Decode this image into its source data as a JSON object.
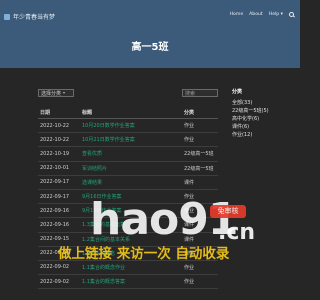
{
  "header": {
    "brand": "年少青春当有梦",
    "nav": [
      "Home",
      "About",
      "Help ▾"
    ]
  },
  "page_title": "高一5班",
  "controls": {
    "category_select": "选择分类",
    "search_placeholder": "搜索"
  },
  "table": {
    "headers": [
      "日期",
      "标题",
      "分类"
    ],
    "rows": [
      {
        "date": "2022-10-22",
        "title": "10月20日数学作业答案",
        "category": "作业"
      },
      {
        "date": "2022-10-22",
        "title": "10月21日数学作业答案",
        "category": "作业"
      },
      {
        "date": "2022-10-19",
        "title": "查看优质",
        "category": "22级高一5班"
      },
      {
        "date": "2022-10-01",
        "title": "军训结照片",
        "category": "22级高一5班"
      },
      {
        "date": "2022-09-17",
        "title": "选课结果",
        "category": "课件"
      },
      {
        "date": "2022-09-17",
        "title": "9月16日作业答案",
        "category": "作业"
      },
      {
        "date": "2022-09-16",
        "title": "9月15日作业答案",
        "category": "作业"
      },
      {
        "date": "2022-09-16",
        "title": "1.3集合的基本运算",
        "category": "课件"
      },
      {
        "date": "2022-09-15",
        "title": "1.2集合间的基本关系",
        "category": "课件"
      },
      {
        "date": "2022-09-04",
        "title": "1.1集合的概念",
        "category": "课件"
      },
      {
        "date": "2022-09-02",
        "title": "1.1集合的概念作业",
        "category": "作业"
      },
      {
        "date": "2022-09-02",
        "title": "1.1集合的概念答案",
        "category": "作业"
      }
    ]
  },
  "sidebar": {
    "heading": "分类",
    "items": [
      "全部(33)",
      "22级高一5班(5)",
      "高中化学(6)",
      "课件(6)",
      "作业(12)"
    ]
  },
  "watermark": {
    "logo": "hao91",
    "logo_suffix": ".cn",
    "badge": "免审核",
    "slogan": "做上链接  来访一次  自动收录"
  }
}
